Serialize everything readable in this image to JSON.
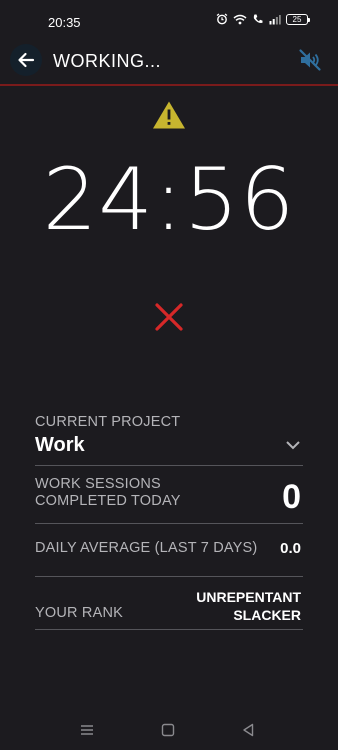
{
  "status_bar": {
    "time": "20:35",
    "battery": "25",
    "icons": [
      "alarm-icon",
      "wifi-icon",
      "call-icon",
      "signal-icon",
      "battery-icon"
    ]
  },
  "app_bar": {
    "title": "WORKING...",
    "back_icon": "arrow-left-icon",
    "mute_icon": "volume-muted-icon",
    "divider_color": "#7a1b1b"
  },
  "timer": {
    "display": "24:56",
    "warning_icon": "warning-triangle-icon",
    "warning_color": "#c7b52f",
    "cancel_icon": "close-x-icon",
    "cancel_color": "#d62828"
  },
  "info": {
    "current_project_label": "CURRENT PROJECT",
    "current_project_value": "Work",
    "sessions_label": "WORK SESSIONS COMPLETED TODAY",
    "sessions_value": "0",
    "average_label": "DAILY AVERAGE (LAST 7 DAYS)",
    "average_value": "0.0",
    "rank_label": "YOUR RANK",
    "rank_value_line1": "UNREPENTANT",
    "rank_value_line2": "SLACKER"
  },
  "nav_bar": {
    "icons": [
      "menu-icon",
      "home-square-icon",
      "back-triangle-icon"
    ]
  }
}
